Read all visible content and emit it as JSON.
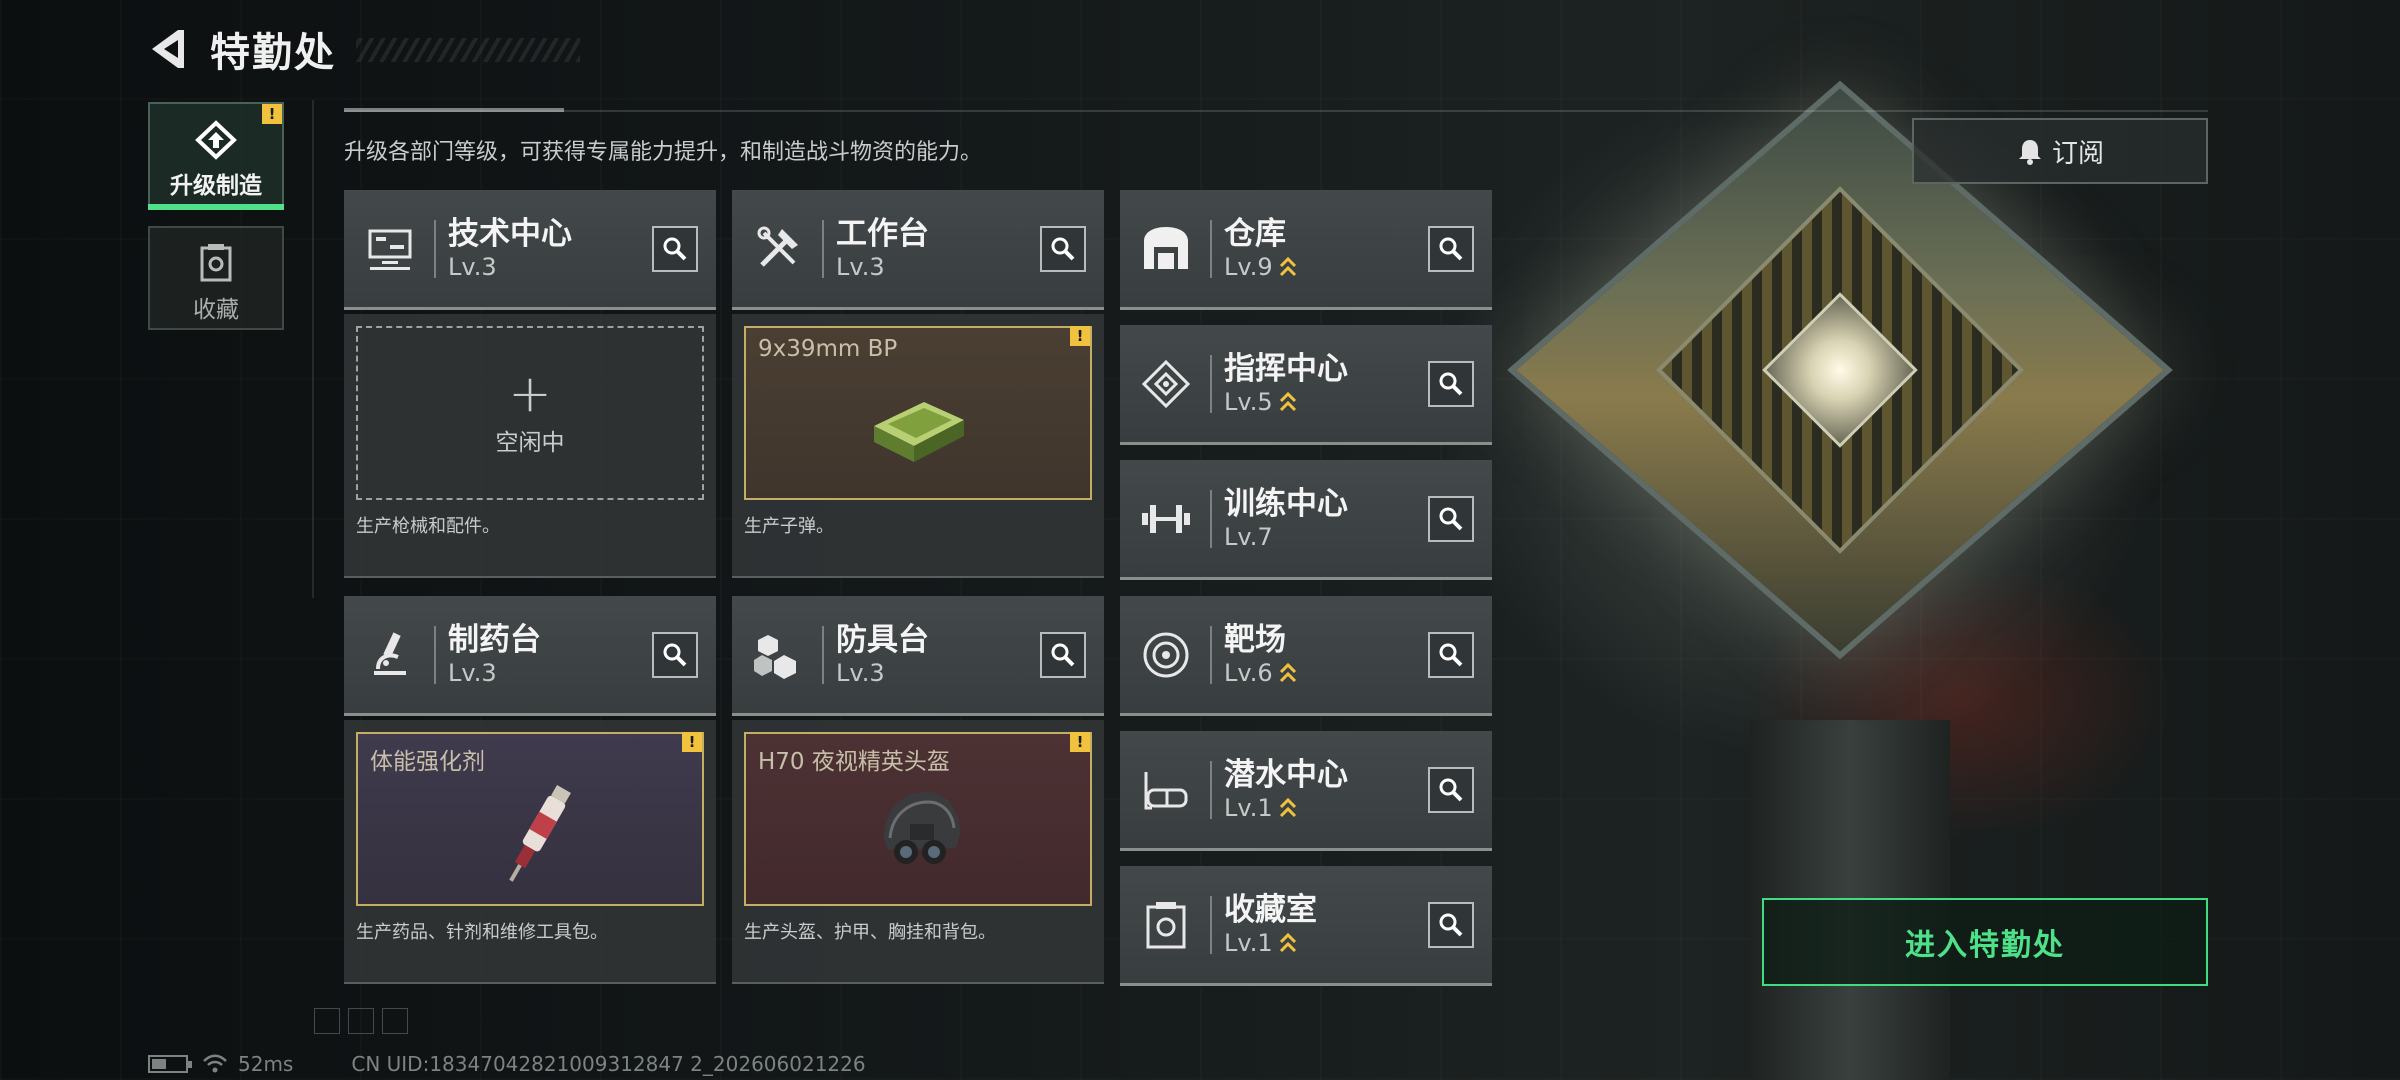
{
  "header": {
    "title": "特勤处"
  },
  "nav": {
    "upgrade_label": "升级制造",
    "collection_label": "收藏"
  },
  "description": "升级各部门等级，可获得专属能力提升，和制造战斗物资的能力。",
  "subscribe_label": "订阅",
  "departments": {
    "tech_center": {
      "name": "技术中心",
      "level": "Lv.3",
      "idle": "空闲中",
      "desc": "生产枪械和配件。"
    },
    "workbench": {
      "name": "工作台",
      "level": "Lv.3",
      "item": "9x39mm BP",
      "desc": "生产子弹。"
    },
    "pharmacy": {
      "name": "制药台",
      "level": "Lv.3",
      "item": "体能强化剂",
      "desc": "生产药品、针剂和维修工具包。"
    },
    "armor_bench": {
      "name": "防具台",
      "level": "Lv.3",
      "item": "H70 夜视精英头盔",
      "desc": "生产头盔、护甲、胸挂和背包。"
    },
    "warehouse": {
      "name": "仓库",
      "level": "Lv.9"
    },
    "command_center": {
      "name": "指挥中心",
      "level": "Lv.5"
    },
    "training_center": {
      "name": "训练中心",
      "level": "Lv.7"
    },
    "shooting_range": {
      "name": "靶场",
      "level": "Lv.6"
    },
    "diving_center": {
      "name": "潜水中心",
      "level": "Lv.1"
    },
    "collection_room": {
      "name": "收藏室",
      "level": "Lv.1"
    }
  },
  "enter_label": "进入特勤处",
  "status": {
    "ping": "52ms",
    "uid": "CN UID:18347042821009312847 2_202606021226"
  },
  "colors": {
    "accent_green": "#4fe08a",
    "warning_yellow": "#f0c23e",
    "slot_gold": "#c4ae63"
  }
}
